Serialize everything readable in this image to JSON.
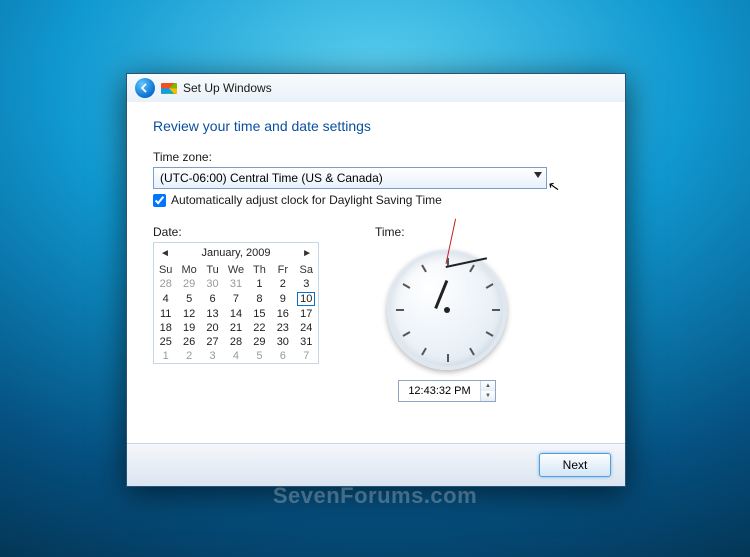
{
  "titlebar": {
    "label": "Set Up Windows"
  },
  "heading": "Review your time and date settings",
  "tz": {
    "label": "Time zone:",
    "value": "(UTC-06:00) Central Time (US & Canada)"
  },
  "dst": {
    "checked": true,
    "label": "Automatically adjust clock for Daylight Saving Time"
  },
  "date_label": "Date:",
  "time_label": "Time:",
  "calendar": {
    "title": "January, 2009",
    "dow": [
      "Su",
      "Mo",
      "Tu",
      "We",
      "Th",
      "Fr",
      "Sa"
    ],
    "weeks": [
      [
        {
          "d": "28",
          "o": true
        },
        {
          "d": "29",
          "o": true
        },
        {
          "d": "30",
          "o": true
        },
        {
          "d": "31",
          "o": true
        },
        {
          "d": "1"
        },
        {
          "d": "2"
        },
        {
          "d": "3"
        }
      ],
      [
        {
          "d": "4"
        },
        {
          "d": "5"
        },
        {
          "d": "6"
        },
        {
          "d": "7"
        },
        {
          "d": "8"
        },
        {
          "d": "9"
        },
        {
          "d": "10",
          "t": true
        }
      ],
      [
        {
          "d": "11"
        },
        {
          "d": "12"
        },
        {
          "d": "13"
        },
        {
          "d": "14"
        },
        {
          "d": "15"
        },
        {
          "d": "16"
        },
        {
          "d": "17"
        }
      ],
      [
        {
          "d": "18"
        },
        {
          "d": "19"
        },
        {
          "d": "20"
        },
        {
          "d": "21"
        },
        {
          "d": "22"
        },
        {
          "d": "23"
        },
        {
          "d": "24"
        }
      ],
      [
        {
          "d": "25"
        },
        {
          "d": "26"
        },
        {
          "d": "27"
        },
        {
          "d": "28"
        },
        {
          "d": "29"
        },
        {
          "d": "30"
        },
        {
          "d": "31"
        }
      ],
      [
        {
          "d": "1",
          "o": true
        },
        {
          "d": "2",
          "o": true
        },
        {
          "d": "3",
          "o": true
        },
        {
          "d": "4",
          "o": true
        },
        {
          "d": "5",
          "o": true
        },
        {
          "d": "6",
          "o": true
        },
        {
          "d": "7",
          "o": true
        }
      ]
    ]
  },
  "time_value": "12:43:32 PM",
  "next_label": "Next",
  "watermark": "SevenForums.com"
}
